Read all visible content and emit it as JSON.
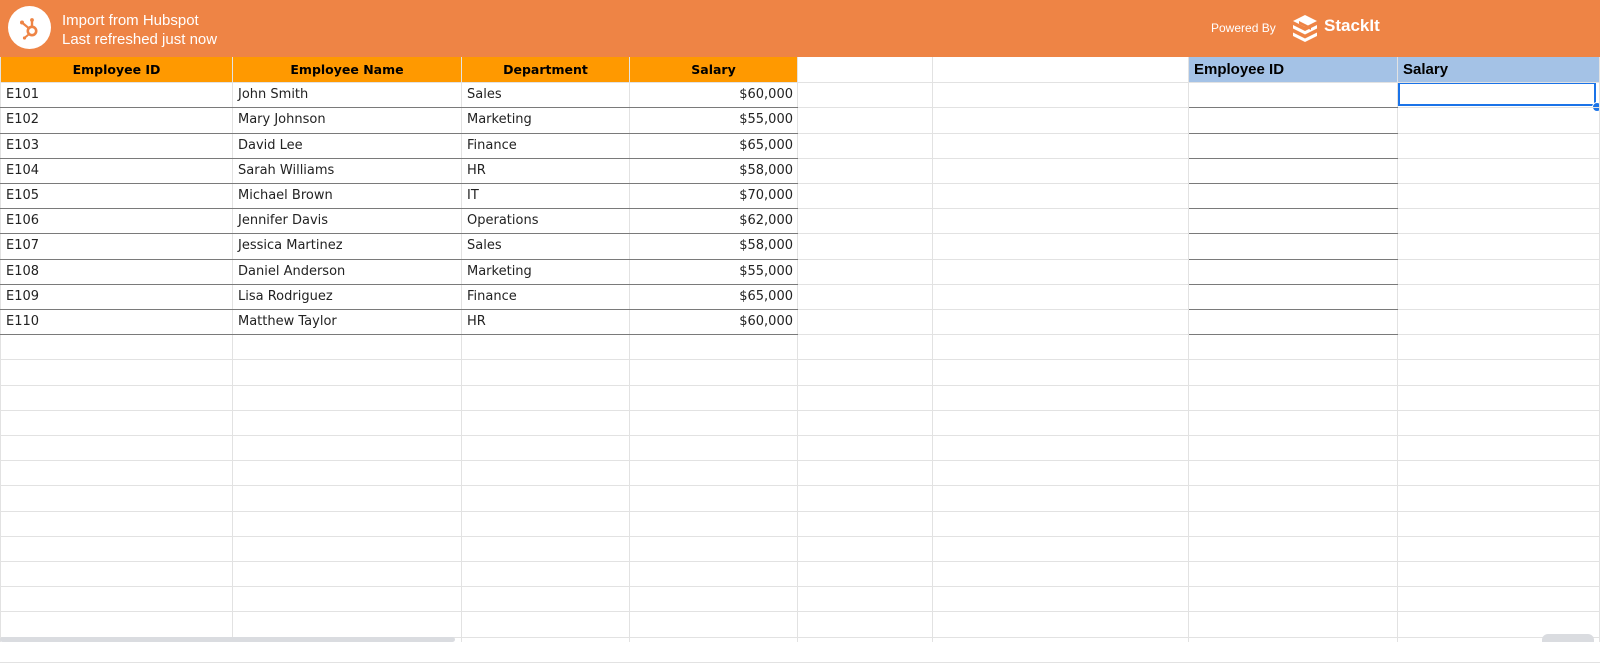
{
  "banner": {
    "title_line1": "Import from Hubspot",
    "title_line2": "Last refreshed just now",
    "powered_by": "Powered By",
    "brand": "StackIt",
    "logo_icon": "hubspot-icon",
    "brand_icon": "stackit-icon",
    "background": "#ee8445"
  },
  "table": {
    "headers": [
      "Employee ID",
      "Employee Name",
      "Department",
      "Salary"
    ],
    "header_color": "#ff9900",
    "rows": [
      [
        "E101",
        "John Smith",
        "Sales",
        "$60,000"
      ],
      [
        "E102",
        "Mary Johnson",
        "Marketing",
        "$55,000"
      ],
      [
        "E103",
        "David Lee",
        "Finance",
        "$65,000"
      ],
      [
        "E104",
        "Sarah Williams",
        "HR",
        "$58,000"
      ],
      [
        "E105",
        "Michael Brown",
        "IT",
        "$70,000"
      ],
      [
        "E106",
        "Jennifer Davis",
        "Operations",
        "$62,000"
      ],
      [
        "E107",
        "Jessica Martinez",
        "Sales",
        "$58,000"
      ],
      [
        "E108",
        "Daniel Anderson",
        "Marketing",
        "$55,000"
      ],
      [
        "E109",
        "Lisa Rodriguez",
        "Finance",
        "$65,000"
      ],
      [
        "E110",
        "Matthew Taylor",
        "HR",
        "$60,000"
      ]
    ]
  },
  "lookup": {
    "headers": [
      "Employee ID",
      "Salary"
    ],
    "header_color": "#a4c2e6"
  },
  "selection_color": "#1a73e8"
}
